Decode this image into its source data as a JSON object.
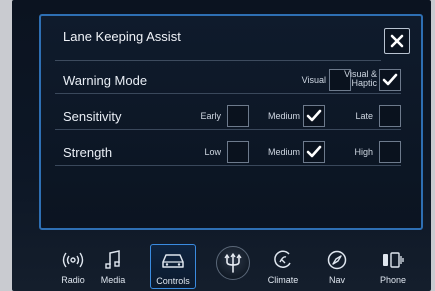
{
  "panel": {
    "title": "Lane Keeping Assist",
    "close_label": "✕"
  },
  "rows": [
    {
      "label": "Warning Mode",
      "options": [
        {
          "label": "Visual",
          "checked": false
        },
        {
          "label": "Visual & Haptic",
          "checked": true
        }
      ]
    },
    {
      "label": "Sensitivity",
      "options": [
        {
          "label": "Early",
          "checked": false
        },
        {
          "label": "Medium",
          "checked": true
        },
        {
          "label": "Late",
          "checked": false
        }
      ]
    },
    {
      "label": "Strength",
      "options": [
        {
          "label": "Low",
          "checked": false
        },
        {
          "label": "Medium",
          "checked": true
        },
        {
          "label": "High",
          "checked": false
        }
      ]
    }
  ],
  "dock": {
    "items": [
      {
        "label": "Radio",
        "icon": "radio-icon",
        "active": false
      },
      {
        "label": "Media",
        "icon": "music-note-icon",
        "active": false
      },
      {
        "label": "Controls",
        "icon": "car-icon",
        "active": true
      },
      {
        "label": "Climate",
        "icon": "climate-icon",
        "active": false
      },
      {
        "label": "Nav",
        "icon": "compass-icon",
        "active": false
      },
      {
        "label": "Phone",
        "icon": "phone-icon",
        "active": false
      }
    ],
    "center_logo": "trident-logo"
  },
  "colors": {
    "accent": "#3a8be0",
    "panel_border": "#2e6fb3",
    "checkmark": "#ffffff",
    "background": "#0b1320"
  }
}
